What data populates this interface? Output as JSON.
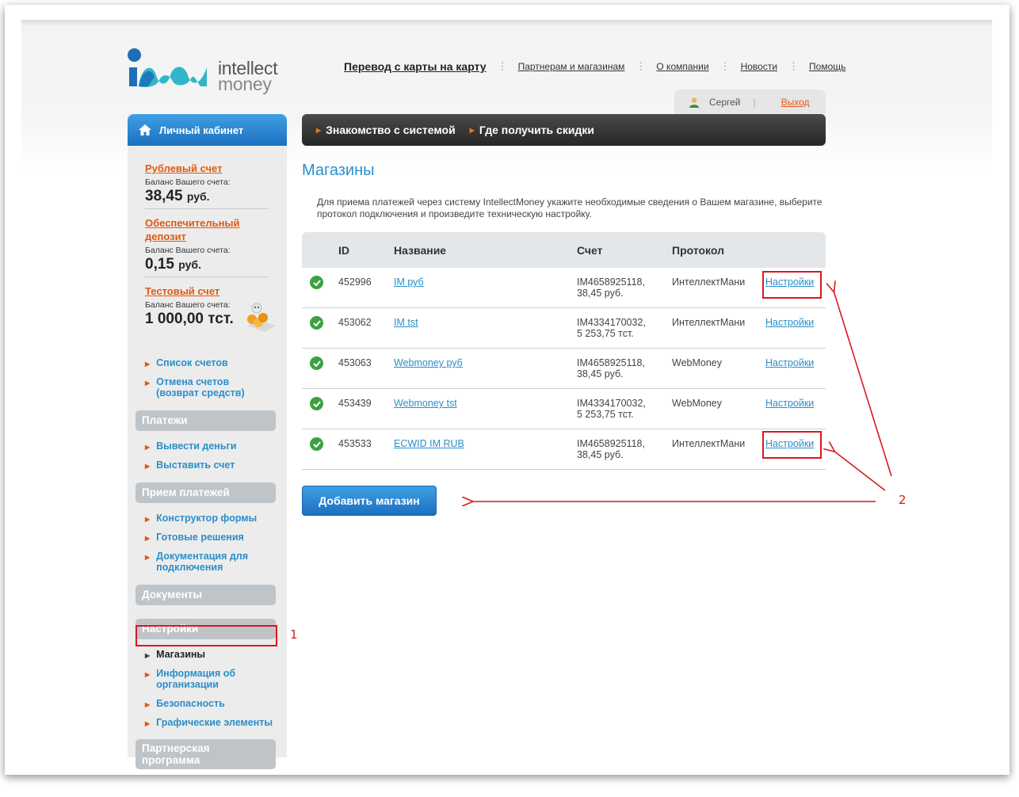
{
  "brand": {
    "line1": "intellect",
    "line2": "money"
  },
  "topnav": {
    "main": "Перевод с карты на карту",
    "items": [
      "Партнерам и магазинам",
      "О компании",
      "Новости",
      "Помощь"
    ]
  },
  "user": {
    "name": "Сергей",
    "logout": "Выход"
  },
  "sidebar": {
    "header": "Личный кабинет",
    "accounts": [
      {
        "title": "Рублевый счет",
        "label": "Баланс Вашего счета:",
        "amount": "38,45",
        "unit": "руб."
      },
      {
        "title": "Обеспечительный депозит",
        "label": "Баланс Вашего счета:",
        "amount": "0,15",
        "unit": "руб."
      },
      {
        "title": "Тестовый счет",
        "label": "Баланс Вашего счета:",
        "amount": "1 000,00",
        "unit": "тст."
      }
    ],
    "account_links": [
      "Список счетов",
      "Отмена счетов (возврат средств)"
    ],
    "sections": [
      {
        "title": "Платежи",
        "items": [
          "Вывести деньги",
          "Выставить счет"
        ]
      },
      {
        "title": "Прием платежей",
        "items": [
          "Конструктор формы",
          "Готовые решения",
          "Документация для подключения"
        ]
      },
      {
        "title": "Документы",
        "items": []
      },
      {
        "title": "Настройки",
        "items": [
          "Магазины",
          "Информация об организации",
          "Безопасность",
          "Графические элементы"
        ]
      },
      {
        "title": "Партнерская программа",
        "items": []
      }
    ],
    "active_item": "Магазины"
  },
  "topbar": {
    "items": [
      "Знакомство с системой",
      "Где получить скидки"
    ]
  },
  "main": {
    "title": "Магазины",
    "intro": "Для приема платежей через систему IntellectMoney укажите необходимые сведения о Вашем магазине, выберите протокол подключения и произведите техническую настройку.",
    "columns": [
      "ID",
      "Название",
      "Счет",
      "Протокол"
    ],
    "rows": [
      {
        "id": "452996",
        "name": "IM руб",
        "account": "IM4658925118,",
        "balance": "38,45 руб.",
        "protocol": "ИнтеллектМани",
        "action": "Настройки"
      },
      {
        "id": "453062",
        "name": "IM tst",
        "account": "IM4334170032,",
        "balance": "5 253,75 тст.",
        "protocol": "ИнтеллектМани",
        "action": "Настройки"
      },
      {
        "id": "453063",
        "name": "Webmoney руб",
        "account": "IM4658925118,",
        "balance": "38,45 руб.",
        "protocol": "WebMoney",
        "action": "Настройки"
      },
      {
        "id": "453439",
        "name": "Webmoney tst",
        "account": "IM4334170032,",
        "balance": "5 253,75 тст.",
        "protocol": "WebMoney",
        "action": "Настройки"
      },
      {
        "id": "453533",
        "name": "ECWID IM RUB",
        "account": "IM4658925118,",
        "balance": "38,45 руб.",
        "protocol": "ИнтеллектМани",
        "action": "Настройки"
      }
    ],
    "add_button": "Добавить магазин"
  },
  "annotations": {
    "marker1": "1",
    "marker2": "2"
  },
  "colors": {
    "accent": "#2a8fc9",
    "orange": "#e05a10",
    "annotation": "#d71920"
  }
}
